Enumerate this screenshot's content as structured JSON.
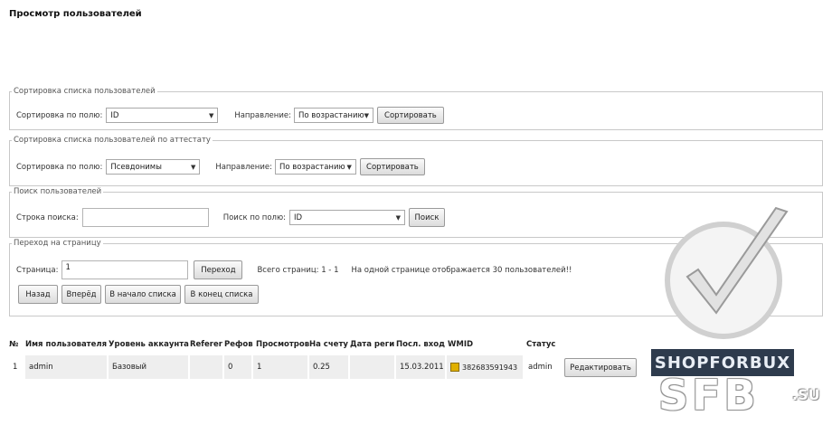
{
  "page": {
    "title": "Просмотр пользователей"
  },
  "sort_users": {
    "legend": "Сортировка списка пользователей",
    "field_label": "Сортировка по полю:",
    "field_value": "ID",
    "direction_label": "Направление:",
    "direction_value": "По возрастанию",
    "button": "Сортировать"
  },
  "sort_attest": {
    "legend": "Сортировка списка пользователей по аттестату",
    "field_label": "Сортировка по полю:",
    "field_value": "Псевдонимы",
    "direction_label": "Направление:",
    "direction_value": "По возрастанию",
    "button": "Сортировать"
  },
  "search": {
    "legend": "Поиск пользователей",
    "query_label": "Строка поиска:",
    "query_value": "",
    "field_label": "Поиск по полю:",
    "field_value": "ID",
    "button": "Поиск"
  },
  "pager": {
    "legend": "Переход на страницу",
    "page_label": "Страница:",
    "page_value": "1",
    "go_button": "Переход",
    "total_text": "Всего страниц: 1 - 1",
    "per_page_text": "На одной странице отображается 30 пользователей!!",
    "back_button": "Назад",
    "forward_button": "Вперёд",
    "start_button": "В начало списка",
    "end_button": "В конец списка"
  },
  "table": {
    "headers": [
      "№",
      "Имя пользователя",
      "Уровень аккаунта",
      "Referer",
      "Рефов",
      "Просмотров",
      "На счету",
      "Дата реги",
      "Посл. вход",
      "WMID",
      "Статус"
    ],
    "row": {
      "num": "1",
      "name": "admin",
      "level": "Базовый",
      "referer": "",
      "refs": "0",
      "views": "1",
      "balance": "0.25",
      "reg_date": "",
      "last_login": "15.03.2011",
      "wmid": "382683591943",
      "status": "admin",
      "edit_button": "Редактировать"
    }
  },
  "watermark": {
    "brand": "SHOPFORBUX",
    "sfb": "SFB",
    "su": ".SU"
  }
}
